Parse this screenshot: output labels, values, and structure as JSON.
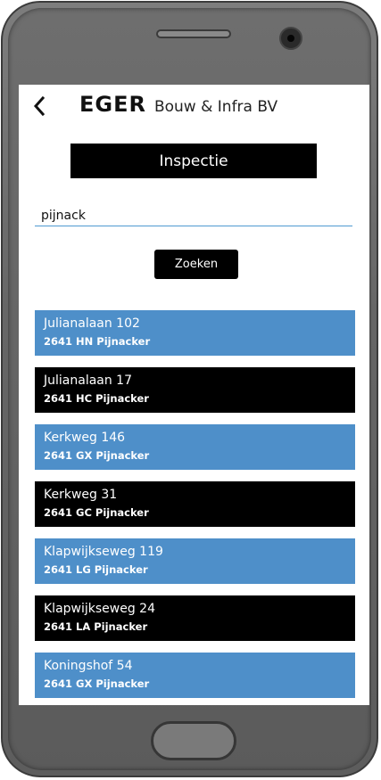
{
  "header": {
    "brand_name": "EGER",
    "brand_sub": "Bouw & Infra BV",
    "back_icon": "chevron-left-icon"
  },
  "title": "Inspectie",
  "search": {
    "value": "pijnack",
    "button_label": "Zoeken"
  },
  "colors": {
    "accent_blue": "#4e8fc9",
    "dark": "#000000"
  },
  "results": [
    {
      "street": "Julianalaan 102",
      "city": "2641 HN Pijnacker",
      "color": "blue"
    },
    {
      "street": "Julianalaan 17",
      "city": "2641 HC Pijnacker",
      "color": "black"
    },
    {
      "street": "Kerkweg 146",
      "city": "2641 GX Pijnacker",
      "color": "blue"
    },
    {
      "street": "Kerkweg 31",
      "city": "2641 GC Pijnacker",
      "color": "black"
    },
    {
      "street": "Klapwijkseweg 119",
      "city": "2641 LG Pijnacker",
      "color": "blue"
    },
    {
      "street": "Klapwijkseweg 24",
      "city": "2641 LA Pijnacker",
      "color": "black"
    },
    {
      "street": "Koningshof 54",
      "city": "2641 GX Pijnacker",
      "color": "blue"
    }
  ]
}
